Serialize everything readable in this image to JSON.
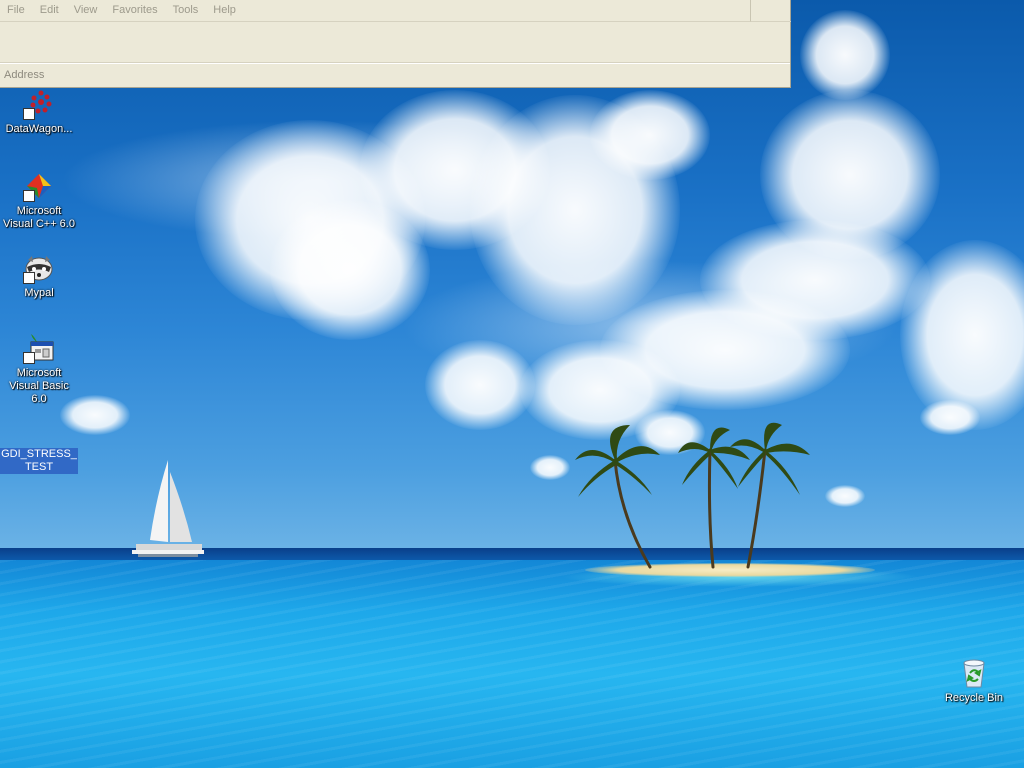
{
  "window": {
    "menu": [
      "File",
      "Edit",
      "View",
      "Favorites",
      "Tools",
      "Help"
    ],
    "address_label": "Address"
  },
  "desktop": {
    "icons": [
      {
        "label": "DataWagon...",
        "icon": "datawagon-icon"
      },
      {
        "label": "Microsoft Visual C++ 6.0",
        "icon": "visual-cpp-icon"
      },
      {
        "label": "Mypal",
        "icon": "mypal-raccoon-icon"
      },
      {
        "label": "Microsoft Visual Basic 6.0",
        "icon": "visual-basic-icon"
      },
      {
        "label": "GDI_STRESS_TEST",
        "icon": "blank-icon",
        "selected": true
      },
      {
        "label": "Recycle Bin",
        "icon": "recycle-bin-icon"
      }
    ]
  },
  "wallpaper": {
    "scene": "tropical-island-beach",
    "colors": {
      "sky": "#1a71c6",
      "sea": "#1ea8ea",
      "sand": "#efe2b0",
      "selection": "#3169c6"
    }
  }
}
